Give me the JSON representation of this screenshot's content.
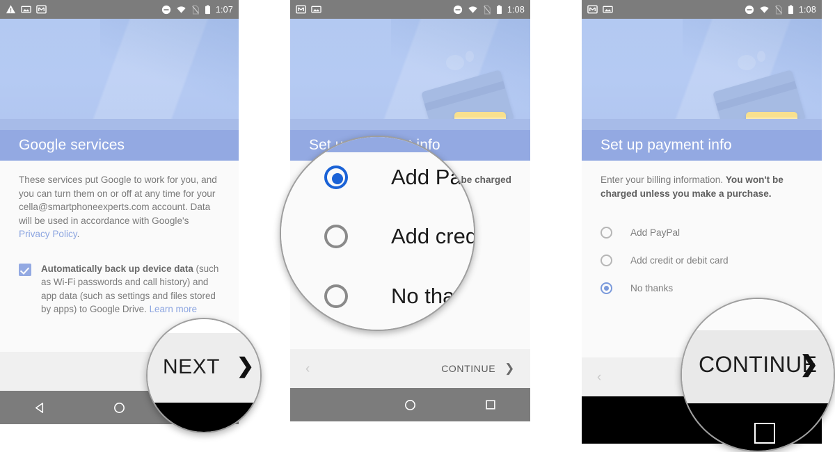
{
  "panels": [
    {
      "id": "google-services",
      "statusbar": {
        "time": "1:07",
        "left_icons": [
          "warning-icon",
          "screenshot-icon",
          "gmail-icon"
        ],
        "right_icons": [
          "do-not-disturb-icon",
          "wifi-icon",
          "no-sim-icon",
          "battery-icon"
        ]
      },
      "title": "Google services",
      "paragraph_1": "These services put Google to work for you, and you can turn them on or off at any time for your cella@smartphoneexperts.com account. Data will be used in accordance with Google's ",
      "privacy_link": "Privacy Policy",
      "paragraph_1_end": ".",
      "checkbox": {
        "checked": true,
        "heading": "Automatically back up device data",
        "description": " (such as Wi-Fi passwords and call history) and app data (such as settings and files stored by apps) to Google Drive. ",
        "link": "Learn more"
      },
      "action_label": "NEXT",
      "action_arrow": "❯",
      "magnifier": {
        "label": "NEXT",
        "arrow": "❯"
      }
    },
    {
      "id": "payment-info-paypal",
      "statusbar": {
        "time": "1:08",
        "left_icons": [
          "gmail-icon",
          "screenshot-icon"
        ],
        "right_icons": [
          "do-not-disturb-icon",
          "wifi-icon",
          "no-sim-icon",
          "battery-icon"
        ]
      },
      "title": "Set up payment info",
      "paragraph_tail": "won't be charged",
      "options": [
        {
          "label": "Add PayPal",
          "selected": true
        },
        {
          "label": "Add credit or debit card",
          "selected": false
        },
        {
          "label": "No thanks",
          "selected": false
        }
      ],
      "back_chevron": "‹",
      "action_label": "CONTINUE",
      "action_arrow": "❯",
      "magnifier": {
        "options": [
          {
            "label": "Add Pa",
            "selected": true
          },
          {
            "label": "Add cred",
            "selected": false
          },
          {
            "label": "No tha",
            "selected": false
          }
        ]
      }
    },
    {
      "id": "payment-info-nothanks",
      "statusbar": {
        "time": "1:08",
        "left_icons": [
          "gmail-icon",
          "screenshot-icon"
        ],
        "right_icons": [
          "do-not-disturb-icon",
          "wifi-icon",
          "no-sim-icon",
          "battery-icon"
        ]
      },
      "title": "Set up payment info",
      "paragraph_plain": "Enter your billing information. ",
      "paragraph_bold": "You won't be charged unless you make a purchase.",
      "options": [
        {
          "label": "Add PayPal",
          "selected": false
        },
        {
          "label": "Add credit or debit card",
          "selected": false
        },
        {
          "label": "No thanks",
          "selected": true
        }
      ],
      "back_chevron": "‹",
      "action_label": "CONTINUE",
      "action_arrow": "❯",
      "magnifier": {
        "label": "CONTINUE",
        "arrow": "❯"
      }
    }
  ],
  "colors": {
    "title_bar": "#93a9e2",
    "hero": "#b3c9f2",
    "accent_link": "#8ba4e0",
    "radio_selected": "#7b9adb",
    "status_bar": "#7c7c7c",
    "card_yellow": "#f8e08e"
  }
}
